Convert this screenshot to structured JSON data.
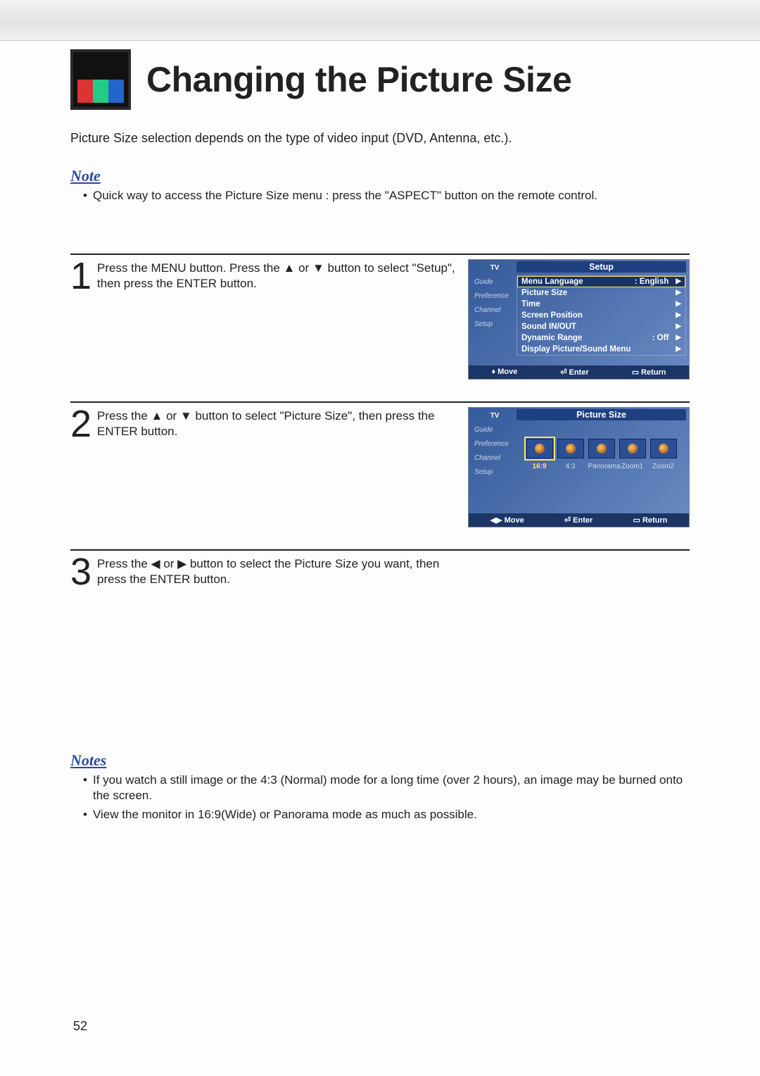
{
  "header": {
    "title": "Changing the Picture Size"
  },
  "intro": "Picture Size selection depends on the type of video input (DVD, Antenna, etc.).",
  "note1": {
    "heading": "Note",
    "items": [
      "Quick way to access the Picture Size menu : press the \"ASPECT\" button on the remote control."
    ]
  },
  "steps": [
    {
      "num": "1",
      "text": "Press the MENU button. Press the ▲ or ▼ button to select \"Setup\", then press the ENTER button."
    },
    {
      "num": "2",
      "text": "Press the ▲ or ▼ button to select \"Picture Size\", then press the ENTER button."
    },
    {
      "num": "3",
      "text": "Press the ◀ or ▶ button to select the Picture Size you want, then press the ENTER button."
    }
  ],
  "osd": {
    "sideTabs": {
      "tv": "TV",
      "guide": "Guide",
      "pref": "Preference",
      "channel": "Channel",
      "setup": "Setup"
    },
    "setup": {
      "banner": "Setup",
      "items": [
        {
          "label": "Menu Language",
          "value": ":  English",
          "sel": true
        },
        {
          "label": "Picture Size",
          "value": ""
        },
        {
          "label": "Time",
          "value": ""
        },
        {
          "label": "Screen Position",
          "value": ""
        },
        {
          "label": "Sound IN/OUT",
          "value": ""
        },
        {
          "label": "Dynamic Range",
          "value": ":  Off"
        },
        {
          "label": "Display Picture/Sound Menu",
          "value": ""
        }
      ]
    },
    "picsize": {
      "banner": "Picture Size",
      "labels": [
        "16:9",
        "4:3",
        "Panorama",
        "Zoom1",
        "Zoom2"
      ]
    },
    "bar": {
      "move_ud": "Move",
      "move_lr": "Move",
      "enter": "Enter",
      "ret": "Return"
    }
  },
  "notes2": {
    "heading": "Notes",
    "items": [
      "If you watch a still image or the 4:3 (Normal) mode for a long time (over 2 hours), an image may be burned onto the screen.",
      "View the monitor in 16:9(Wide) or Panorama mode as much as possible."
    ]
  },
  "pageNumber": "52"
}
